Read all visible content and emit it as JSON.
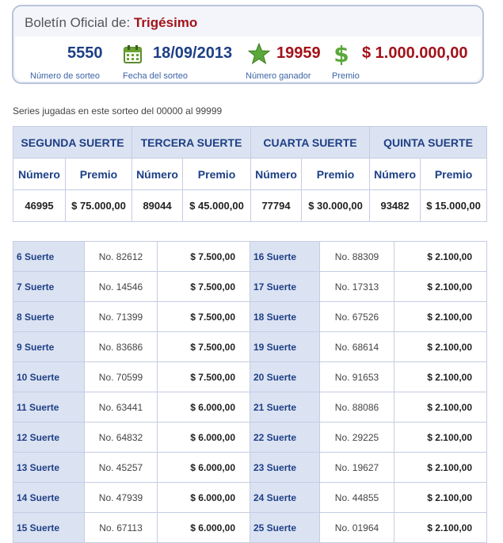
{
  "header": {
    "prefix": "Boletín Oficial de:",
    "draw_name": "Trigésimo",
    "numero_sorteo": "5550",
    "numero_sorteo_label": "Número de sorteo",
    "fecha": "18/09/2013",
    "fecha_label": "Fecha del sorteo",
    "ganador": "19959",
    "ganador_label": "Número ganador",
    "premio": "$ 1.000.000,00",
    "premio_label": "Premio"
  },
  "series_info": "Series jugadas en este sorteo del 00000 al 99999",
  "main_prizes": {
    "col_numero": "Número",
    "col_premio": "Premio",
    "groups": [
      {
        "title": "SEGUNDA SUERTE",
        "numero": "46995",
        "premio": "$ 75.000,00"
      },
      {
        "title": "TERCERA SUERTE",
        "numero": "89044",
        "premio": "$ 45.000,00"
      },
      {
        "title": "CUARTA SUERTE",
        "numero": "77794",
        "premio": "$ 30.000,00"
      },
      {
        "title": "QUINTA SUERTE",
        "numero": "93482",
        "premio": "$ 15.000,00"
      }
    ]
  },
  "minor_prizes": [
    {
      "left": {
        "label": "6 Suerte",
        "numero": "No. 82612",
        "premio": "$ 7.500,00"
      },
      "right": {
        "label": "16 Suerte",
        "numero": "No. 88309",
        "premio": "$ 2.100,00"
      }
    },
    {
      "left": {
        "label": "7 Suerte",
        "numero": "No. 14546",
        "premio": "$ 7.500,00"
      },
      "right": {
        "label": "17 Suerte",
        "numero": "No. 17313",
        "premio": "$ 2.100,00"
      }
    },
    {
      "left": {
        "label": "8 Suerte",
        "numero": "No. 71399",
        "premio": "$ 7.500,00"
      },
      "right": {
        "label": "18 Suerte",
        "numero": "No. 67526",
        "premio": "$ 2.100,00"
      }
    },
    {
      "left": {
        "label": "9 Suerte",
        "numero": "No. 83686",
        "premio": "$ 7.500,00"
      },
      "right": {
        "label": "19 Suerte",
        "numero": "No. 68614",
        "premio": "$ 2.100,00"
      }
    },
    {
      "left": {
        "label": "10 Suerte",
        "numero": "No. 70599",
        "premio": "$ 7.500,00"
      },
      "right": {
        "label": "20 Suerte",
        "numero": "No. 91653",
        "premio": "$ 2.100,00"
      }
    },
    {
      "left": {
        "label": "11 Suerte",
        "numero": "No. 63441",
        "premio": "$ 6.000,00"
      },
      "right": {
        "label": "21 Suerte",
        "numero": "No. 88086",
        "premio": "$ 2.100,00"
      }
    },
    {
      "left": {
        "label": "12 Suerte",
        "numero": "No. 64832",
        "premio": "$ 6.000,00"
      },
      "right": {
        "label": "22 Suerte",
        "numero": "No. 29225",
        "premio": "$ 2.100,00"
      }
    },
    {
      "left": {
        "label": "13 Suerte",
        "numero": "No. 45257",
        "premio": "$ 6.000,00"
      },
      "right": {
        "label": "23 Suerte",
        "numero": "No. 19627",
        "premio": "$ 2.100,00"
      }
    },
    {
      "left": {
        "label": "14 Suerte",
        "numero": "No. 47939",
        "premio": "$ 6.000,00"
      },
      "right": {
        "label": "24 Suerte",
        "numero": "No. 44855",
        "premio": "$ 2.100,00"
      }
    },
    {
      "left": {
        "label": "15 Suerte",
        "numero": "No. 67113",
        "premio": "$ 6.000,00"
      },
      "right": {
        "label": "25 Suerte",
        "numero": "No. 01964",
        "premio": "$ 2.100,00"
      }
    }
  ]
}
